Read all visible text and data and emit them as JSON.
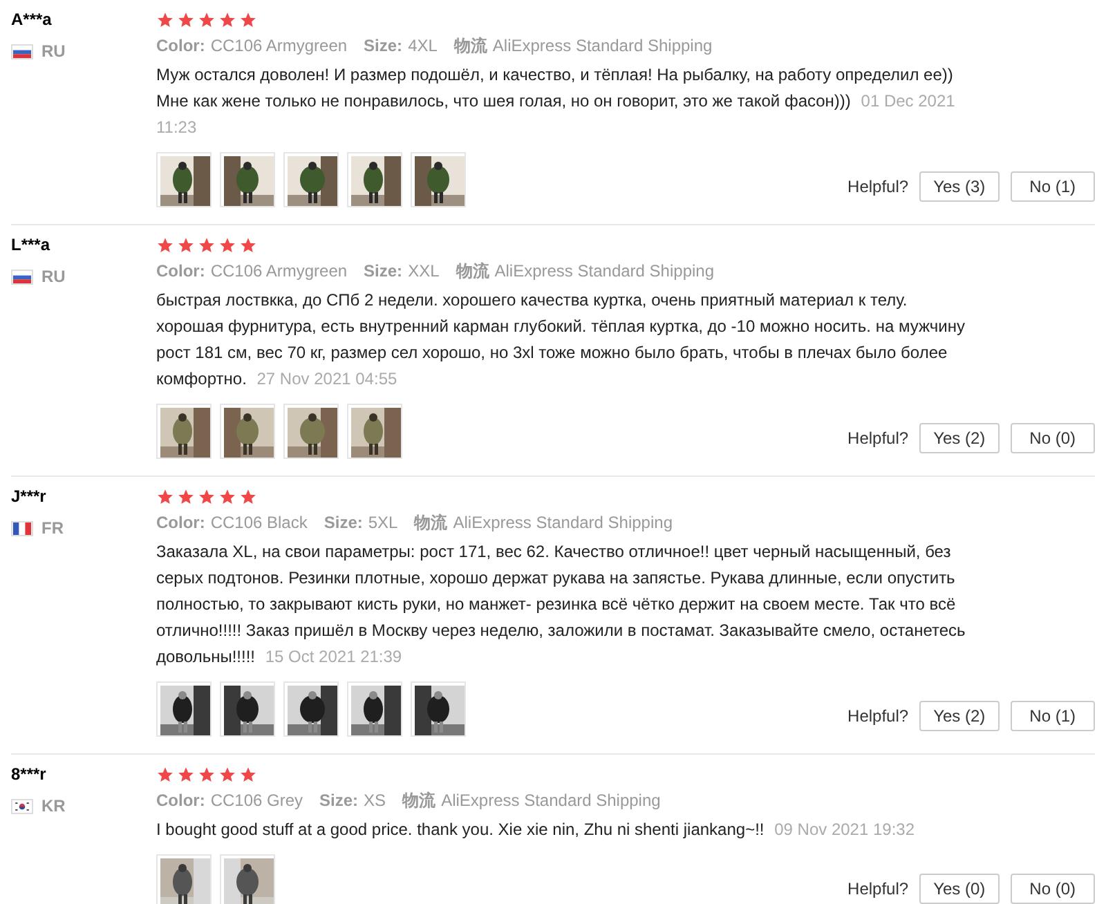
{
  "reviews": [
    {
      "name": "A***a",
      "kind": "ru",
      "country": "RU",
      "stars": 5,
      "color_label": "Color:",
      "variant": "CC106 Armygreen",
      "size_label": "Size:",
      "size": "4XL",
      "shipping_label": "物流",
      "shipping": "AliExpress Standard Shipping",
      "text": "Муж остался доволен! И размер подошёл, и качество, и тёплая! На рыбалку, на работу определил ее)) Мне как жене только не понравилось, что шея голая, но он говорит, это же такой фасон)))",
      "date": "01 Dec 2021 11:23",
      "photos": [
        {
          "kind": "picture"
        },
        {
          "kind": "picture"
        },
        {
          "kind": "picture"
        },
        {
          "kind": "picture"
        },
        {
          "kind": "picture"
        }
      ],
      "helpful": "Helpful?",
      "yes": "Yes (3)",
      "no": "No (1)"
    },
    {
      "name": "L***a",
      "kind": "ru",
      "country": "RU",
      "stars": 5,
      "color_label": "Color:",
      "variant": "CC106 Armygreen",
      "size_label": "Size:",
      "size": "XXL",
      "shipping_label": "物流",
      "shipping": "AliExpress Standard Shipping",
      "text": "быстрая лоствкка, до СПб 2 недели. хорошего качества куртка, очень приятный материал к телу. хорошая фурнитура, есть внутренний карман глубокий. тёплая куртка, до -10 можно носить. на мужчину рост 181 см, вес 70 кг, размер сел хорошо, но 3xl тоже можно было брать, чтобы в плечах было более комфортно.",
      "date": "27 Nov 2021 04:55",
      "photos": [
        {
          "kind": "picture"
        },
        {
          "kind": "picture"
        },
        {
          "kind": "picture"
        },
        {
          "kind": "picture"
        }
      ],
      "helpful": "Helpful?",
      "yes": "Yes (2)",
      "no": "No (0)"
    },
    {
      "name": "J***r",
      "kind": "fr",
      "country": "FR",
      "stars": 5,
      "color_label": "Color:",
      "variant": "CC106 Black",
      "size_label": "Size:",
      "size": "5XL",
      "shipping_label": "物流",
      "shipping": "AliExpress Standard Shipping",
      "text": "Заказала XL, на свои параметры: рост 171, вес 62. Качество отличное!! цвет черный насыщенный, без серых подтонов. Резинки плотные, хорошо держат рукава на запястье. Рукава длинные, если опустить полностью, то закрывают кисть руки, но манжет- резинка всё чётко держит на своем месте. Так что всё отлично!!!!! Заказ пришёл в Москву через неделю, заложили в постамат. Заказывайте смело, останетесь довольны!!!!!",
      "date": "15 Oct 2021 21:39",
      "photos": [
        {
          "kind": "picture"
        },
        {
          "kind": "picture"
        },
        {
          "kind": "picture"
        },
        {
          "kind": "picture"
        },
        {
          "kind": "picture"
        }
      ],
      "helpful": "Helpful?",
      "yes": "Yes (2)",
      "no": "No (1)"
    },
    {
      "name": "8***r",
      "kind": "kr",
      "country": "KR",
      "stars": 5,
      "color_label": "Color:",
      "variant": "CC106 Grey",
      "size_label": "Size:",
      "size": "XS",
      "shipping_label": "物流",
      "shipping": "AliExpress Standard Shipping",
      "text": "I bought good stuff at a good price. thank you. Xie xie nin, Zhu ni shenti jiankang~!!",
      "date": "09 Nov 2021 19:32",
      "photos": [
        {
          "kind": "picture"
        },
        {
          "kind": "picture"
        }
      ],
      "helpful": "Helpful?",
      "yes": "Yes (0)",
      "no": "No (0)"
    }
  ]
}
